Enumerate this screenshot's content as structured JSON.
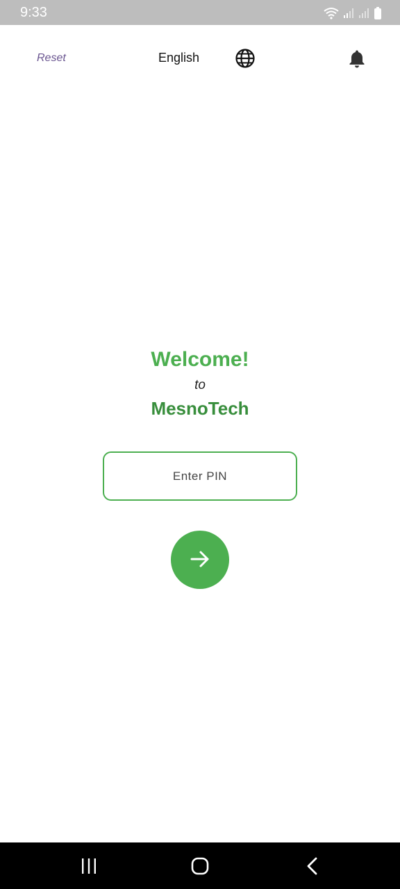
{
  "status_bar": {
    "time": "9:33",
    "icons": [
      "wifi-icon",
      "signal-icon",
      "signal-icon",
      "battery-icon"
    ],
    "background": "#bdbdbd"
  },
  "app_bar": {
    "reset_label": "Reset",
    "language_label": "English",
    "language_icon": "globe-icon",
    "notification_icon": "bell-icon"
  },
  "welcome": {
    "title": "Welcome!",
    "connector": "to",
    "brand": "MesnoTech"
  },
  "pin_input": {
    "placeholder": "Enter PIN",
    "value": ""
  },
  "submit": {
    "icon": "arrow-right-icon"
  },
  "nav_bar": {
    "buttons": [
      "recents-icon",
      "home-icon",
      "back-icon"
    ]
  },
  "colors": {
    "accent": "#4caf50",
    "brand_dark": "#388e3c",
    "reset_purple": "#6a5590"
  }
}
